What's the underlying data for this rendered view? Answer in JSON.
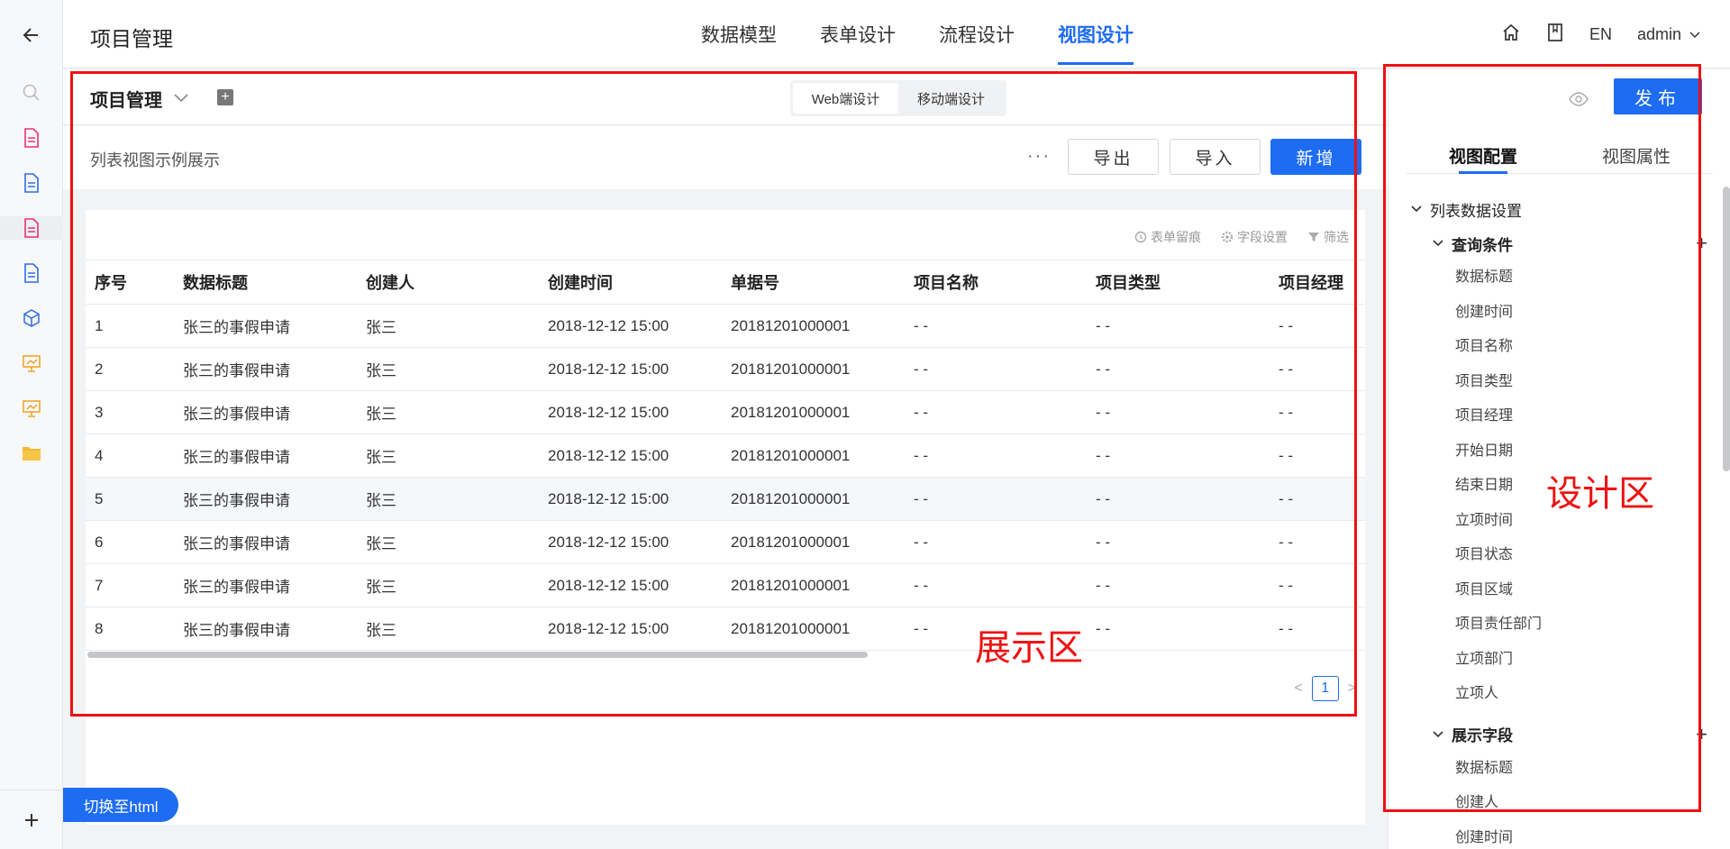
{
  "header": {
    "app_title": "项目管理",
    "nav_tabs": [
      "数据模型",
      "表单设计",
      "流程设计",
      "视图设计"
    ],
    "active_tab": "视图设计",
    "lang": "EN",
    "user": "admin"
  },
  "canvas": {
    "project_name": "项目管理",
    "mode_options": [
      "Web端设计",
      "移动端设计"
    ],
    "active_mode": "Web端设计",
    "view_desc": "列表视图示例展示",
    "more": "···",
    "export_label": "导出",
    "import_label": "导入",
    "new_label": "新增",
    "table_tools": [
      "表单留痕",
      "字段设置",
      "筛选"
    ],
    "columns": [
      "序号",
      "数据标题",
      "创建人",
      "创建时间",
      "单据号",
      "项目名称",
      "项目类型",
      "项目经理"
    ],
    "rows": [
      [
        "1",
        "张三的事假申请",
        "张三",
        "2018-12-12 15:00",
        "20181201000001",
        "- -",
        "- -",
        "- -"
      ],
      [
        "2",
        "张三的事假申请",
        "张三",
        "2018-12-12 15:00",
        "20181201000001",
        "- -",
        "- -",
        "- -"
      ],
      [
        "3",
        "张三的事假申请",
        "张三",
        "2018-12-12 15:00",
        "20181201000001",
        "- -",
        "- -",
        "- -"
      ],
      [
        "4",
        "张三的事假申请",
        "张三",
        "2018-12-12 15:00",
        "20181201000001",
        "- -",
        "- -",
        "- -"
      ],
      [
        "5",
        "张三的事假申请",
        "张三",
        "2018-12-12 15:00",
        "20181201000001",
        "- -",
        "- -",
        "- -"
      ],
      [
        "6",
        "张三的事假申请",
        "张三",
        "2018-12-12 15:00",
        "20181201000001",
        "- -",
        "- -",
        "- -"
      ],
      [
        "7",
        "张三的事假申请",
        "张三",
        "2018-12-12 15:00",
        "20181201000001",
        "- -",
        "- -",
        "- -"
      ],
      [
        "8",
        "张三的事假申请",
        "张三",
        "2018-12-12 15:00",
        "20181201000001",
        "- -",
        "- -",
        "- -"
      ]
    ],
    "highlighted_row": 5,
    "page_prev": "<",
    "page_current": "1",
    "page_next": ">",
    "switch_html": "切换至html"
  },
  "annotations": {
    "display_area": "展示区",
    "design_area": "设计区",
    "color": "#ee1111"
  },
  "panel": {
    "publish_label": "发布",
    "tabs": [
      "视图配置",
      "视图属性"
    ],
    "active_tab": "视图配置",
    "section_title": "列表数据设置",
    "query_title": "查询条件",
    "query_fields": [
      "数据标题",
      "创建时间",
      "项目名称",
      "项目类型",
      "项目经理",
      "开始日期",
      "结束日期",
      "立项时间",
      "项目状态",
      "项目区域",
      "项目责任部门",
      "立项部门",
      "立项人"
    ],
    "display_title": "展示字段",
    "display_fields": [
      "数据标题",
      "创建人",
      "创建时间"
    ]
  },
  "rail_icons": [
    "back-arrow-icon",
    "search-icon",
    "doc-icon",
    "doc-icon",
    "doc-icon",
    "doc-icon",
    "cube-icon",
    "presentation-icon",
    "presentation-icon",
    "folder-icon",
    "plus-icon"
  ],
  "accent_color": "#1d6cf2"
}
